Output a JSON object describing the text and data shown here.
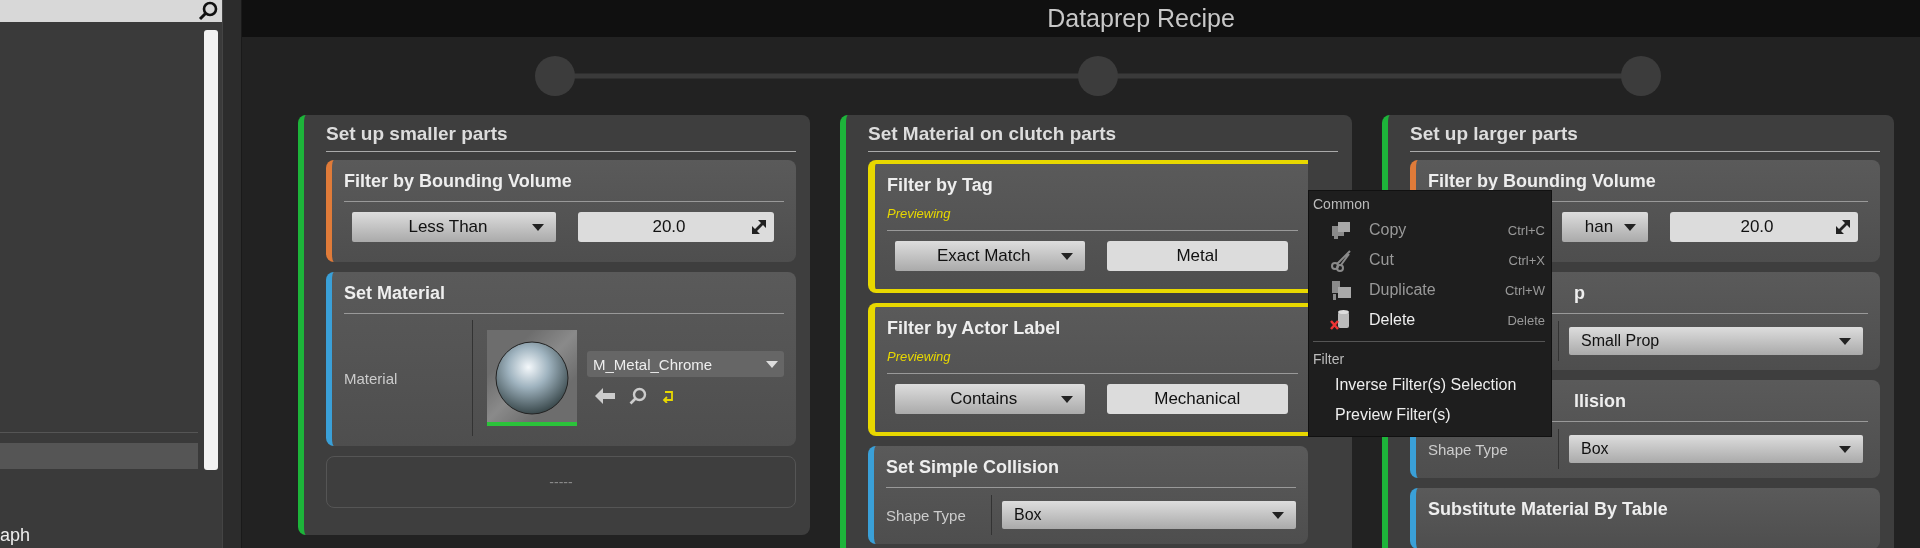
{
  "left_panel": {
    "rows": [
      {
        "label": "",
        "selected": true
      }
    ],
    "footer_text": "aph"
  },
  "window": {
    "title": "Dataprep Recipe"
  },
  "columns": [
    {
      "title": "Set up smaller parts",
      "color": "#1db43a",
      "steps": [
        {
          "kind": "range_filter",
          "title": "Filter by Bounding Volume",
          "color": "#e07b39",
          "previewing": false,
          "dropdown": "Less Than",
          "value": "20.0"
        },
        {
          "kind": "material",
          "title": "Set Material",
          "color": "#3aa0d8",
          "previewing": false,
          "label": "Material",
          "dropdown": "M_Metal_Chrome"
        }
      ],
      "drop_zone": "-----"
    },
    {
      "title": "Set Material on clutch parts",
      "color": "#1db43a",
      "steps": [
        {
          "kind": "filter",
          "title": "Filter by Tag",
          "color": "#e8d800",
          "previewing": true,
          "status": "Previewing",
          "dropdown": "Exact Match",
          "value": "Metal"
        },
        {
          "kind": "filter",
          "title": "Filter by Actor Label",
          "color": "#e8d800",
          "previewing": true,
          "status": "Previewing",
          "dropdown": "Contains",
          "value": "Mechanical"
        },
        {
          "kind": "property",
          "title": "Set Simple Collision",
          "color": "#3aa0d8",
          "previewing": false,
          "label": "Shape Type",
          "dropdown": "Box"
        }
      ]
    },
    {
      "title": "Set up larger parts",
      "color": "#1db43a",
      "steps": [
        {
          "kind": "range_filter",
          "title": "Filter by Bounding Volume",
          "color": "#e07b39",
          "previewing": false,
          "dropdown": "han",
          "value": "20.0"
        },
        {
          "kind": "property",
          "title": "p",
          "previewing": false,
          "dropdown": "Small Prop"
        },
        {
          "kind": "property",
          "title": "llision",
          "color": "#3aa0d8",
          "previewing": false,
          "label": "Shape Type",
          "dropdown": "Box"
        },
        {
          "kind": "stub",
          "title": "Substitute Material By Table",
          "color": "#3aa0d8",
          "previewing": false
        }
      ]
    }
  ],
  "context_menu": {
    "sections": [
      {
        "heading": "Common",
        "items": [
          {
            "label": "Copy",
            "shortcut": "Ctrl+C",
            "disabled": true
          },
          {
            "label": "Cut",
            "shortcut": "Ctrl+X",
            "disabled": true
          },
          {
            "label": "Duplicate",
            "shortcut": "Ctrl+W",
            "disabled": true
          },
          {
            "label": "Delete",
            "shortcut": "Delete",
            "disabled": false
          }
        ]
      },
      {
        "heading": "Filter",
        "items": [
          {
            "label": "Inverse Filter(s) Selection",
            "disabled": false
          },
          {
            "label": "Preview Filter(s)",
            "disabled": false
          }
        ]
      }
    ]
  }
}
